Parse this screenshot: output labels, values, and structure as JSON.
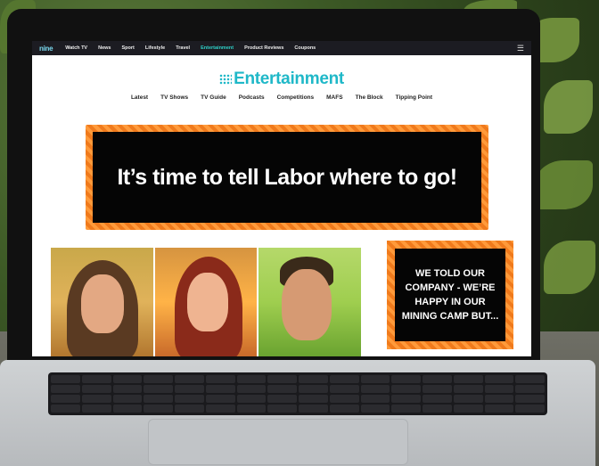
{
  "topnav": {
    "logo": "nine",
    "items": [
      "Watch TV",
      "News",
      "Sport",
      "Lifestyle",
      "Travel",
      "Entertainment",
      "Product Reviews",
      "Coupons"
    ],
    "active": "Entertainment"
  },
  "brand": {
    "title": "Entertainment"
  },
  "subnav": {
    "items": [
      "Latest",
      "TV Shows",
      "TV Guide",
      "Podcasts",
      "Competitions",
      "MAFS",
      "The Block",
      "Tipping Point"
    ]
  },
  "banner": {
    "headline": "It’s time to tell Labor where to go!"
  },
  "ad2": {
    "text": "WE TOLD OUR COMPANY - WE’RE HAPPY IN OUR MINING CAMP BUT..."
  },
  "colors": {
    "accent": "#1fb8c8",
    "ad_border": "#f07a1c",
    "nav_bg": "#1c1c22"
  }
}
